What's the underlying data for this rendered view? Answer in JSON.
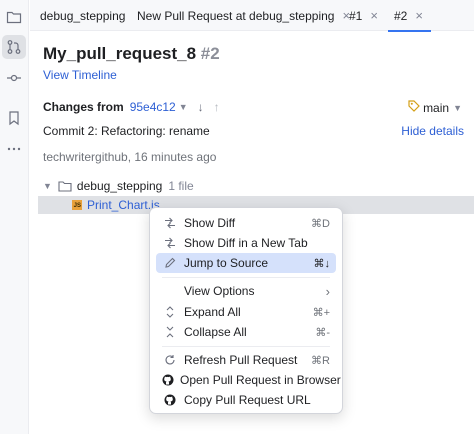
{
  "toolstrip": {
    "items": [
      {
        "name": "project-icon",
        "active": false
      },
      {
        "name": "pull-requests-icon",
        "active": true
      },
      {
        "name": "commit-icon",
        "active": false
      },
      {
        "name": "bookmarks-icon",
        "active": false
      },
      {
        "name": "more-icon",
        "active": false
      }
    ]
  },
  "tabs": [
    {
      "label": "debug_stepping",
      "closable": false
    },
    {
      "label": "New Pull Request at debug_stepping",
      "closable": true
    },
    {
      "label": "#1",
      "closable": true
    },
    {
      "label": "#2",
      "closable": true,
      "active": true
    }
  ],
  "pr": {
    "title": "My_pull_request_8",
    "number": "#2",
    "view_timeline": "View Timeline",
    "changes_from_label": "Changes from",
    "from_hash": "95e4c12",
    "branch": "main",
    "commit": "Commit 2: Refactoring: rename",
    "hide_details": "Hide details",
    "author": "techwritergithub, 16 minutes ago"
  },
  "tree": {
    "directory": "debug_stepping",
    "file_count": "1 file",
    "file": "Print_Chart.js",
    "file_badge": "JS"
  },
  "menu": {
    "items": [
      {
        "label": "Show Diff",
        "shortcut": "⌘D",
        "icon": "diff-icon"
      },
      {
        "label": "Show Diff in a New Tab",
        "shortcut": "",
        "icon": "diff-tab-icon"
      },
      {
        "label": "Jump to Source",
        "shortcut": "⌘↓",
        "icon": "pencil-icon",
        "highlighted": true
      },
      {
        "label": "View Options",
        "shortcut": "›",
        "icon": ""
      },
      {
        "label": "Expand All",
        "shortcut": "⌘+",
        "icon": "expand-icon"
      },
      {
        "label": "Collapse All",
        "shortcut": "⌘-",
        "icon": "collapse-icon"
      },
      {
        "label": "Refresh Pull Request",
        "shortcut": "⌘R",
        "icon": "refresh-icon"
      },
      {
        "label": "Open Pull Request in Browser",
        "shortcut": "",
        "icon": "github-icon"
      },
      {
        "label": "Copy Pull Request URL",
        "shortcut": "",
        "icon": "github-icon"
      }
    ]
  },
  "colors": {
    "accent": "#3574f0",
    "link": "#2d5fd4",
    "highlight": "#d5e1fb"
  }
}
